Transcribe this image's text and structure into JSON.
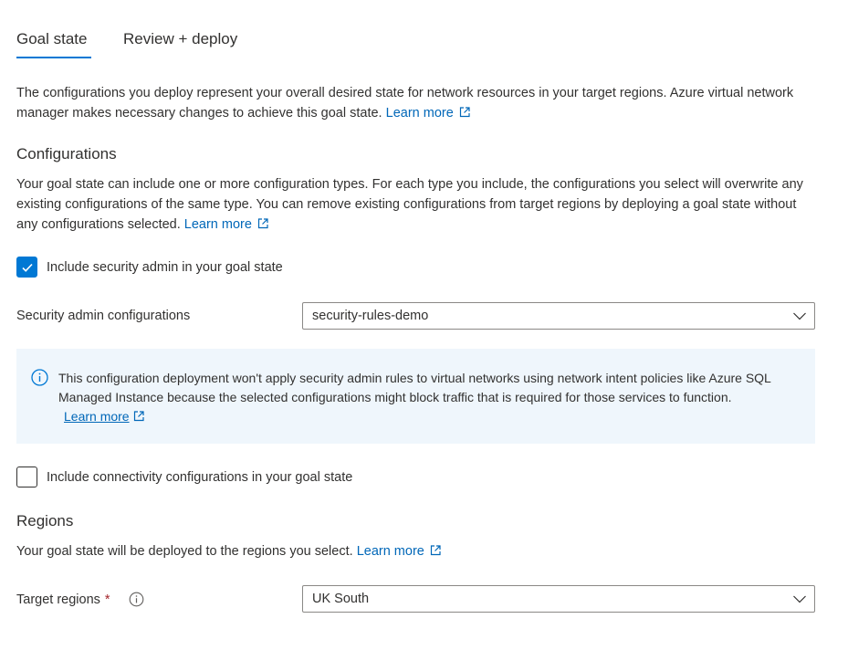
{
  "tabs": [
    {
      "label": "Goal state",
      "active": true
    },
    {
      "label": "Review + deploy",
      "active": false
    }
  ],
  "intro": {
    "text": "The configurations you deploy represent your overall desired state for network resources in your target regions. Azure virtual network manager makes necessary changes to achieve this goal state.",
    "link": "Learn more"
  },
  "configurations": {
    "heading": "Configurations",
    "text": "Your goal state can include one or more configuration types. For each type you include, the configurations you select will overwrite any existing configurations of the same type. You can remove existing configurations from target regions by deploying a goal state without any configurations selected.",
    "link": "Learn more",
    "security_checkbox": {
      "label": "Include security admin in your goal state",
      "checked": true
    },
    "security_field": {
      "label": "Security admin configurations",
      "value": "security-rules-demo"
    },
    "info": {
      "text": "This configuration deployment won't apply security admin rules to virtual networks using network intent policies like Azure SQL Managed Instance because the selected configurations might block traffic that is required for those services to function.",
      "link": "Learn more"
    },
    "connectivity_checkbox": {
      "label": "Include connectivity configurations in your goal state",
      "checked": false
    }
  },
  "regions": {
    "heading": "Regions",
    "text": "Your goal state will be deployed to the regions you select.",
    "link": "Learn more",
    "target_field": {
      "label": "Target regions",
      "required_mark": "*",
      "value": "UK South"
    }
  },
  "colors": {
    "accent": "#0078d4",
    "link": "#0067b8",
    "info_bg": "#eff6fc",
    "required": "#a4262c"
  }
}
